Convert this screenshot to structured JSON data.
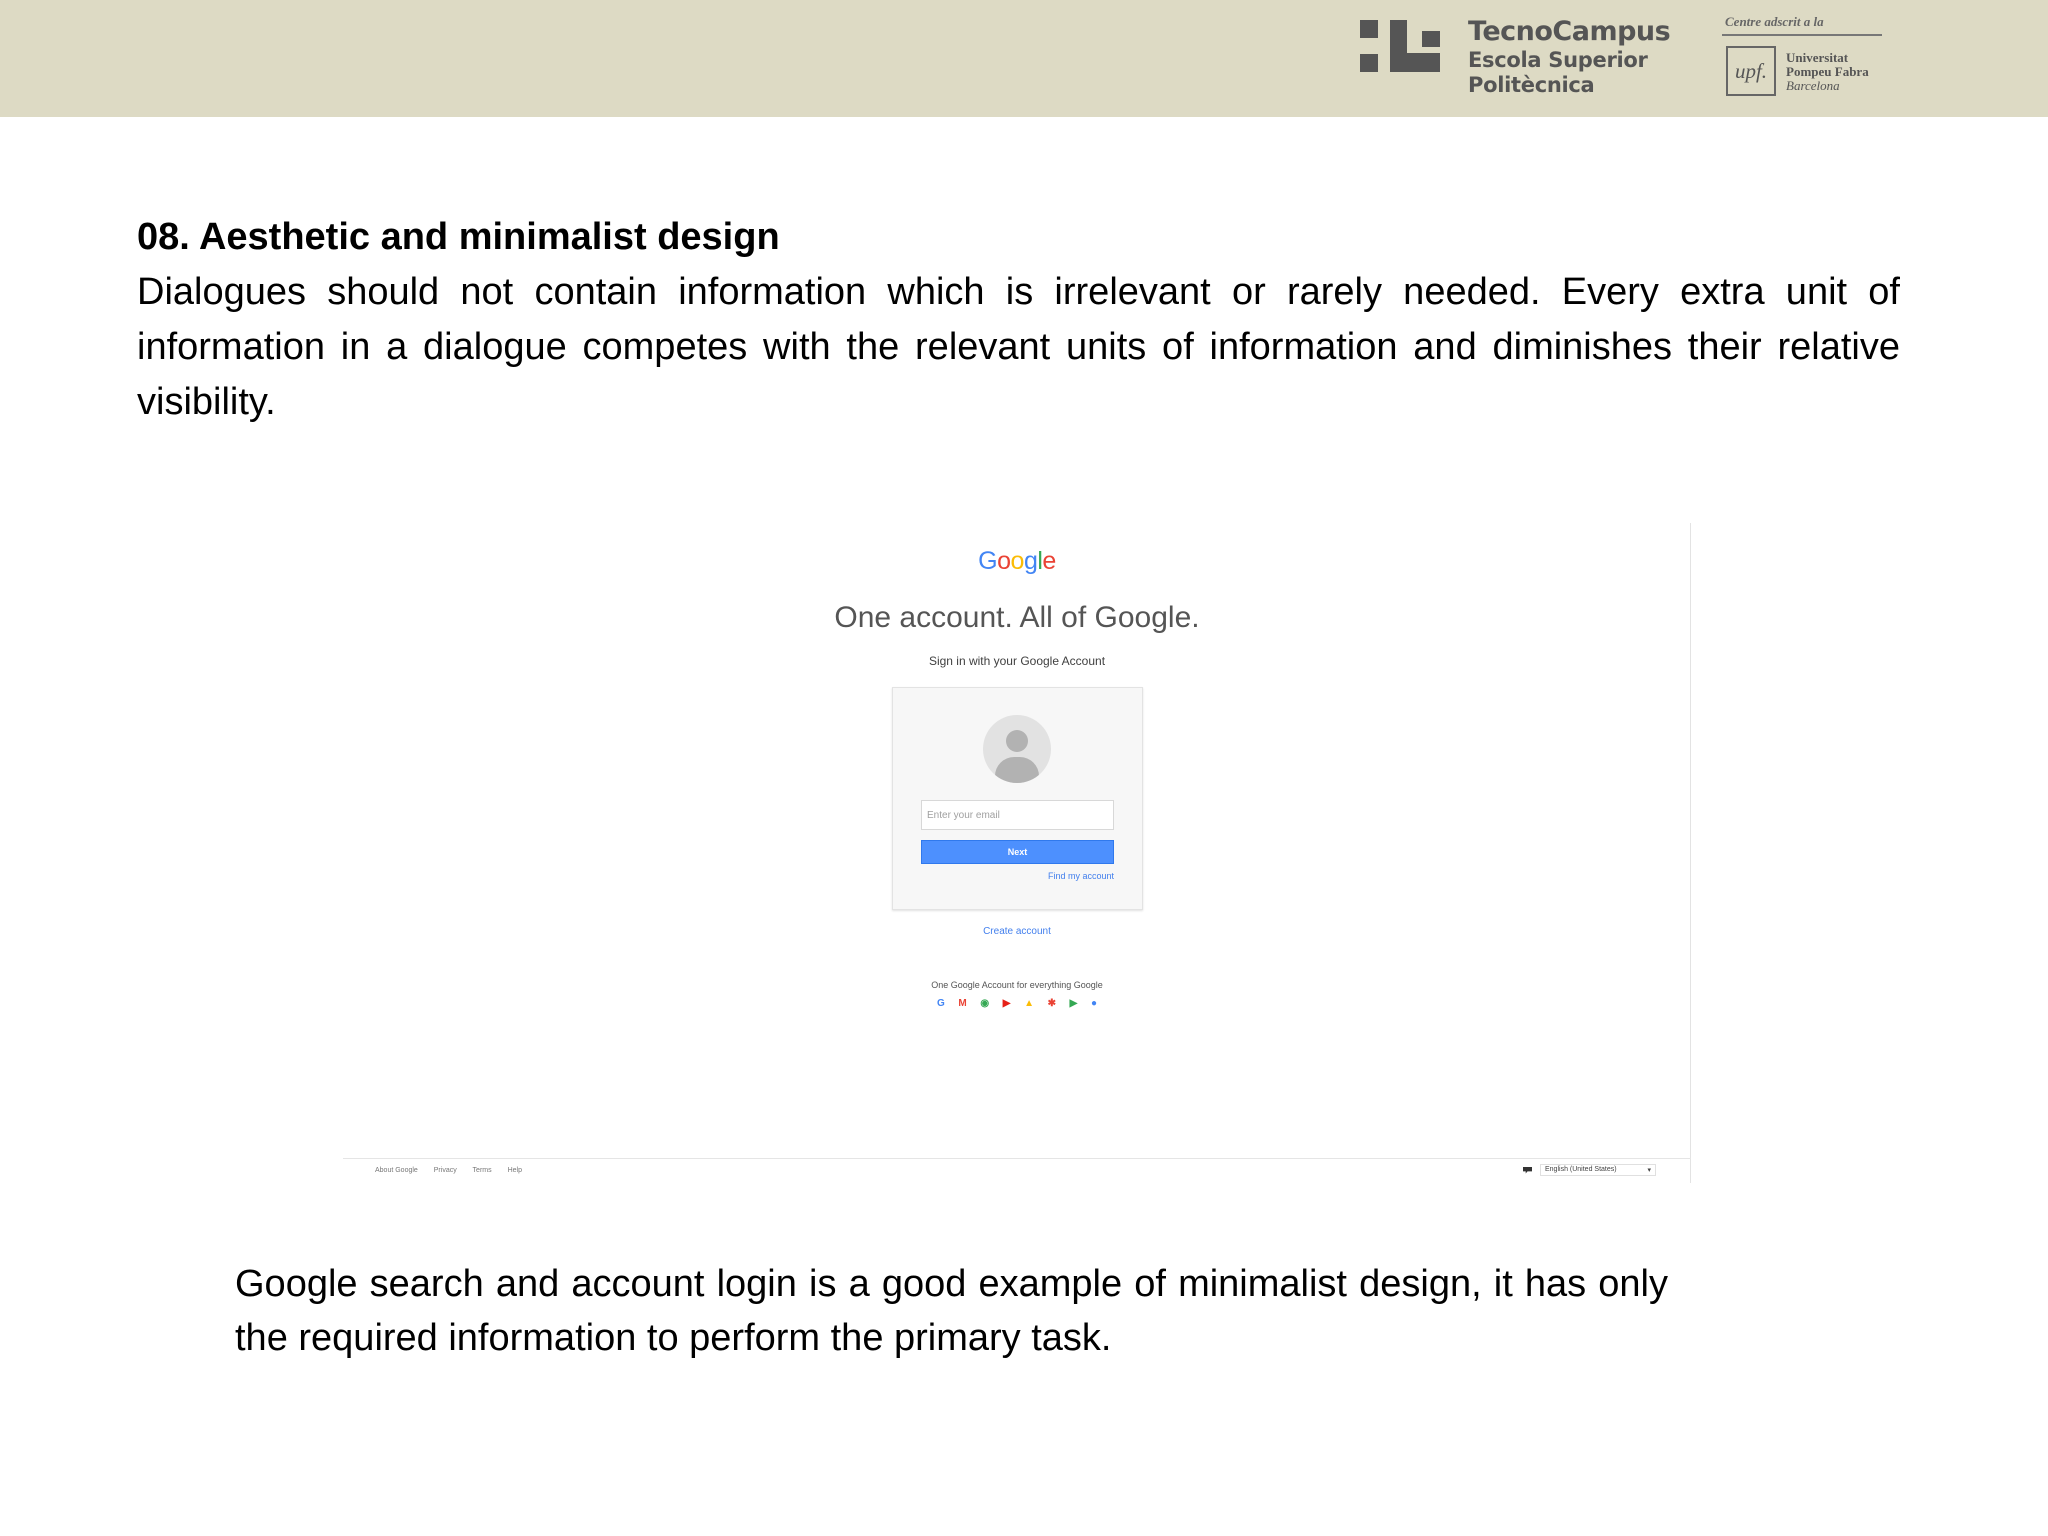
{
  "header": {
    "school_name_line1": "TecnoCampus",
    "school_name_line2": "Escola Superior",
    "school_name_line3": "Politècnica",
    "affiliation_caption": "Centre adscrit a la",
    "university_mark": "upf.",
    "university_line1": "Universitat",
    "university_line2": "Pompeu Fabra",
    "university_line3": "Barcelona",
    "band_color": "#dddac4"
  },
  "slide": {
    "title": "08. Aesthetic and minimalist design",
    "body": "Dialogues should not contain information which is irrelevant or rarely needed. Every extra unit of information in a dialogue competes with the relevant units of information and diminishes their relative visibility.",
    "caption": "Google search and account login is a good example of minimalist design, it has only the required information to perform the primary task."
  },
  "screenshot": {
    "logo_letters": [
      {
        "char": "G",
        "color": "#4285f4"
      },
      {
        "char": "o",
        "color": "#ea4335"
      },
      {
        "char": "o",
        "color": "#fbbc05"
      },
      {
        "char": "g",
        "color": "#4285f4"
      },
      {
        "char": "l",
        "color": "#34a853"
      },
      {
        "char": "e",
        "color": "#ea4335"
      }
    ],
    "heading": "One account. All of Google.",
    "subheading": "Sign in with your Google Account",
    "email_placeholder": "Enter your email",
    "next_label": "Next",
    "find_account_link": "Find my account",
    "create_account_link": "Create account",
    "tagline": "One Google Account for everything Google",
    "product_icons": [
      {
        "name": "google-icon",
        "glyph": "G",
        "color": "#4285f4"
      },
      {
        "name": "gmail-icon",
        "glyph": "M",
        "color": "#ea4335"
      },
      {
        "name": "maps-icon",
        "glyph": "◉",
        "color": "#34a853"
      },
      {
        "name": "youtube-icon",
        "glyph": "▶",
        "color": "#e62117"
      },
      {
        "name": "drive-icon",
        "glyph": "▲",
        "color": "#fbbc05"
      },
      {
        "name": "photos-icon",
        "glyph": "✱",
        "color": "#ea4335"
      },
      {
        "name": "play-icon",
        "glyph": "▶",
        "color": "#34a853"
      },
      {
        "name": "chrome-icon",
        "glyph": "●",
        "color": "#4285f4"
      }
    ],
    "footer_links": [
      "About Google",
      "Privacy",
      "Terms",
      "Help"
    ],
    "language": "English (United States)",
    "accent_color": "#4d90fe"
  }
}
